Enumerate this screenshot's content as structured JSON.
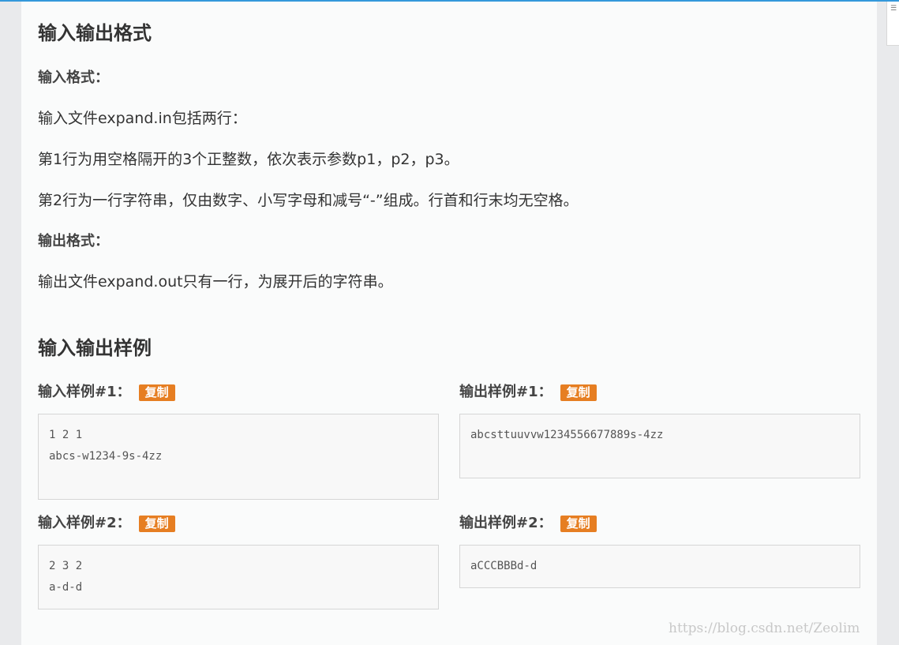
{
  "io_format": {
    "heading": "输入输出格式",
    "input_label": "输入格式：",
    "input_lines": [
      "输入文件expand.in包括两行：",
      "第1行为用空格隔开的3个正整数，依次表示参数p1，p2，p3。",
      "第2行为一行字符串，仅由数字、小写字母和减号“-”组成。行首和行末均无空格。"
    ],
    "output_label": "输出格式：",
    "output_lines": [
      "输出文件expand.out只有一行，为展开后的字符串。"
    ]
  },
  "samples": {
    "heading": "输入输出样例",
    "copy_label": "复制",
    "items": [
      {
        "input_title": "输入样例#1：",
        "input_text": "1 2 1\nabcs-w1234-9s-4zz",
        "output_title": "输出样例#1：",
        "output_text": "abcsttuuvvw1234556677889s-4zz"
      },
      {
        "input_title": "输入样例#2：",
        "input_text": "2 3 2\na-d-d",
        "output_title": "输出样例#2：",
        "output_text": "aCCCBBBd-d"
      }
    ]
  },
  "watermark": "https://blog.csdn.net/Zeolim",
  "colors": {
    "accent_top": "#3498db",
    "copy_button": "#e67e22"
  }
}
